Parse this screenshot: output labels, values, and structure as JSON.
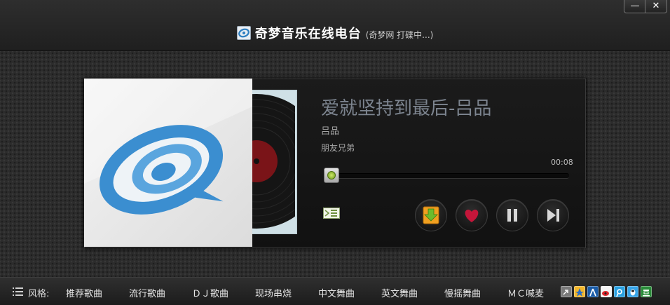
{
  "window": {
    "title": "奇梦音乐在线电台",
    "status": "(奇梦网 打碟中...)",
    "minimize_label": "—",
    "close_label": "✕"
  },
  "player": {
    "song_title": "爱就坚持到最后-吕品",
    "artist": "吕品",
    "album": "朋友兄弟",
    "time": "00:08",
    "progress": 0.03,
    "controls": [
      "download-icon",
      "heart-icon",
      "pause-icon",
      "next-track-icon"
    ],
    "accent": "#7aa64a"
  },
  "bottom": {
    "style_label": "风格:",
    "genres": [
      "推荐歌曲",
      "流行歌曲",
      "ＤＪ歌曲",
      "现场串烧",
      "中文舞曲",
      "英文舞曲",
      "慢摇舞曲",
      "ＭＣ喊麦"
    ],
    "share_icons": [
      "share-icon",
      "qzone-icon",
      "renren-icon",
      "weibo-icon",
      "tencent-weibo-icon",
      "qq-icon",
      "douban-icon"
    ]
  }
}
